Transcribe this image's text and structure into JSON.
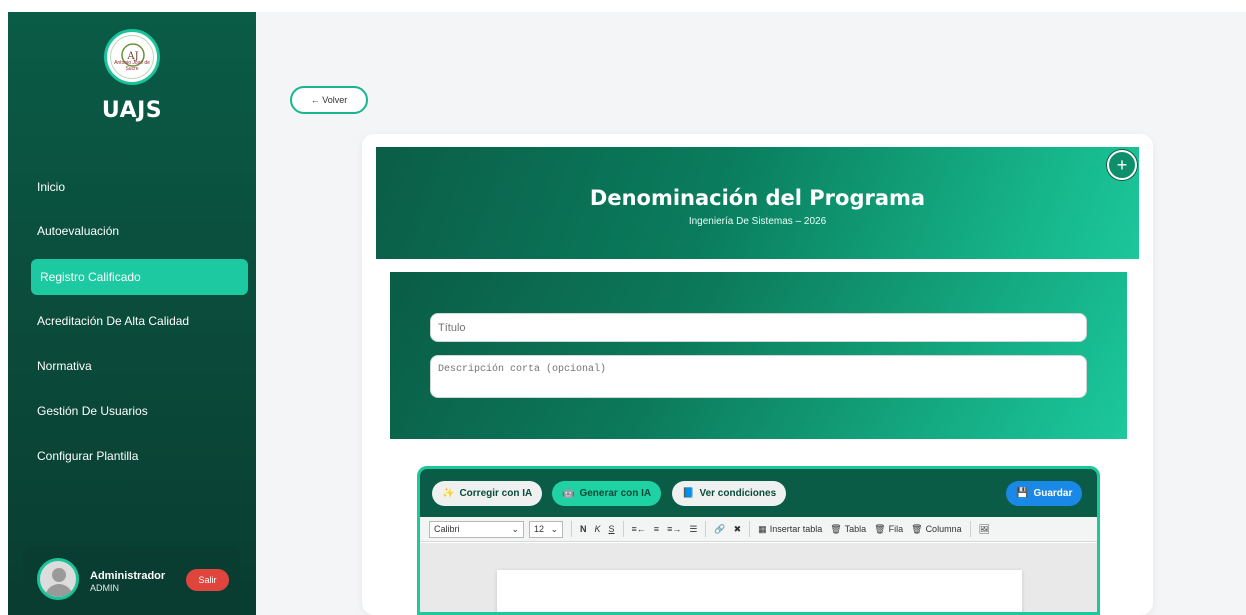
{
  "sidebar": {
    "logo_text": "Antonio José de Sucre",
    "brand": "UAJS",
    "items": [
      {
        "label": "Inicio"
      },
      {
        "label": "Autoevaluación"
      },
      {
        "label": "Registro Calificado"
      },
      {
        "label": "Acreditación De Alta Calidad"
      },
      {
        "label": "Normativa"
      },
      {
        "label": "Gestión De Usuarios"
      },
      {
        "label": "Configurar Plantilla"
      }
    ],
    "user": {
      "name": "Administrador",
      "role": "ADMIN",
      "logout_label": "Salir"
    }
  },
  "main": {
    "back_label": "← Volver",
    "hero": {
      "title": "Denominación del Programa",
      "subtitle": "Ingeniería De Sistemas – 2026",
      "add_label": "+"
    },
    "form": {
      "title_placeholder": "Título",
      "desc_placeholder": "Descripción corta (opcional)"
    },
    "editor": {
      "buttons": {
        "correct": "Corregir con IA",
        "generate": "Generar con IA",
        "conditions": "Ver condiciones",
        "save": "Guardar"
      },
      "toolbar": {
        "font": "Calibri",
        "size": "12",
        "bold": "N",
        "italic": "K",
        "strike": "S",
        "insert_table": "Insertar tabla",
        "table": "Tabla",
        "row": "Fila",
        "column": "Columna"
      }
    }
  },
  "colors": {
    "primary": "#0b5c47",
    "accent": "#1cc99d",
    "danger": "#e0453d",
    "save": "#1a88e6"
  }
}
